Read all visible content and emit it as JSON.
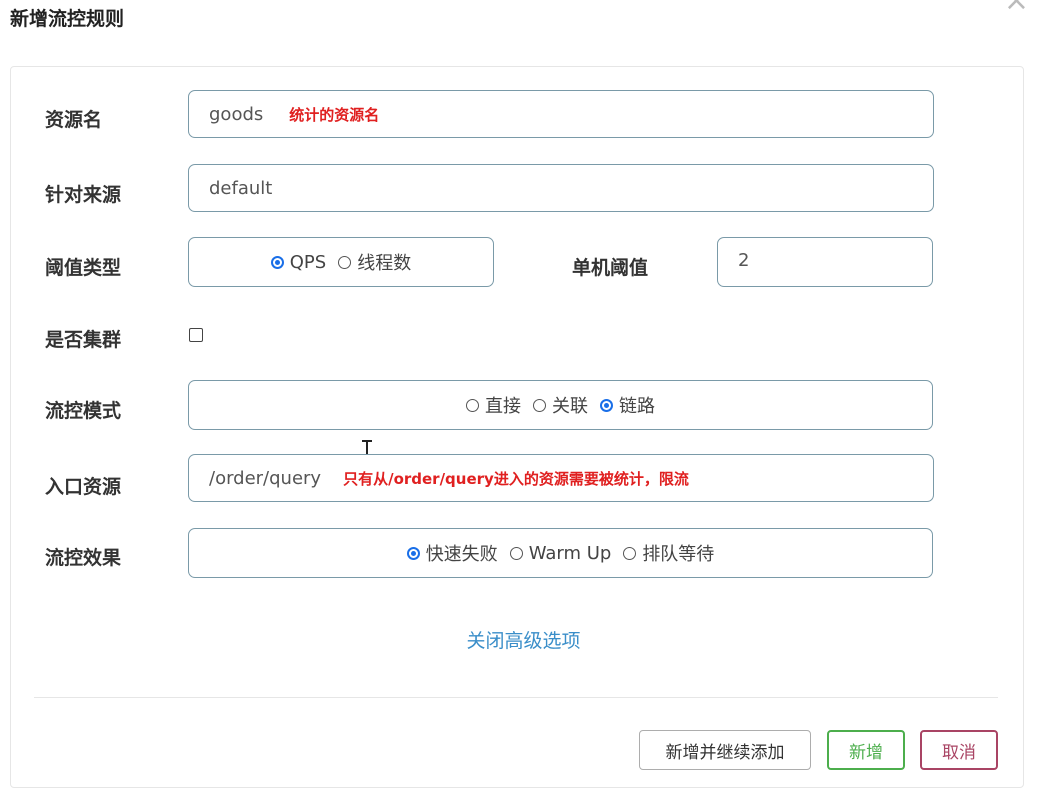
{
  "dialog": {
    "title": "新增流控规则"
  },
  "form": {
    "resource_name": {
      "label": "资源名",
      "value": "goods",
      "note": "统计的资源名"
    },
    "limit_app": {
      "label": "针对来源",
      "value": "default"
    },
    "threshold_type": {
      "label": "阈值类型",
      "options": [
        "QPS",
        "线程数"
      ],
      "selected": "QPS"
    },
    "single_threshold": {
      "label": "单机阈值",
      "value": "2"
    },
    "cluster_mode": {
      "label": "是否集群",
      "checked": false
    },
    "flow_mode": {
      "label": "流控模式",
      "options": [
        "直接",
        "关联",
        "链路"
      ],
      "selected": "链路"
    },
    "entry_resource": {
      "label": "入口资源",
      "value": "/order/query",
      "note": "只有从/order/query进入的资源需要被统计，限流"
    },
    "control_behavior": {
      "label": "流控效果",
      "options": [
        "快速失败",
        "Warm Up",
        "排队等待"
      ],
      "selected": "快速失败"
    }
  },
  "advanced_toggle": "关闭高级选项",
  "footer": {
    "add_continue_label": "新增并继续添加",
    "add_label": "新增",
    "cancel_label": "取消"
  }
}
